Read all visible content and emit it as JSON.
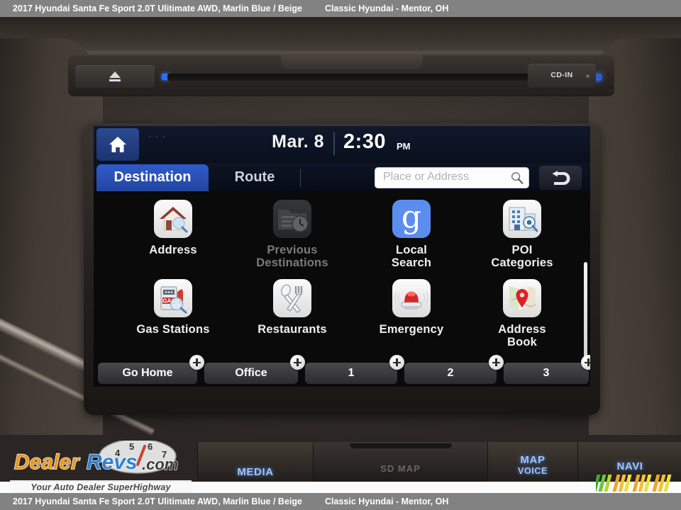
{
  "caption": {
    "vehicle": "2017 Hyundai Santa Fe Sport 2.0T Ulitimate AWD,  Marlin Blue / Beige",
    "dealer": "Classic Hyundai - Mentor, OH"
  },
  "head_unit": {
    "eject_icon": "eject-icon",
    "cd_in_label": "CD-IN"
  },
  "nav": {
    "status": {
      "home_icon": "home-icon",
      "dots": "· · ·",
      "date": "Mar.  8",
      "time": "2:30",
      "ampm": "PM"
    },
    "tabs": [
      {
        "label": "Destination",
        "active": true
      },
      {
        "label": "Route",
        "active": false
      }
    ],
    "search": {
      "placeholder": "Place or Address",
      "icon": "search-icon"
    },
    "back_icon": "back-arrow-icon",
    "grid": [
      {
        "label": "Address",
        "icon": "house-search-icon",
        "dim": false
      },
      {
        "label": "Previous\nDestinations",
        "icon": "folder-clock-icon",
        "dim": true
      },
      {
        "label": "Local\nSearch",
        "icon": "google-g-icon",
        "dim": false
      },
      {
        "label": "POI\nCategories",
        "icon": "building-search-icon",
        "dim": false
      },
      {
        "label": "Gas Stations",
        "icon": "gas-pump-icon",
        "dim": false
      },
      {
        "label": "Restaurants",
        "icon": "fork-spoon-icon",
        "dim": false
      },
      {
        "label": "Emergency",
        "icon": "siren-icon",
        "dim": false
      },
      {
        "label": "Address\nBook",
        "icon": "map-pin-icon",
        "dim": false
      }
    ],
    "shortcuts": [
      {
        "label": "Go Home",
        "badge": "+"
      },
      {
        "label": "Office",
        "badge": "+"
      },
      {
        "label": "1",
        "badge": "+"
      },
      {
        "label": "2",
        "badge": "+"
      },
      {
        "label": "3",
        "badge": "+"
      }
    ]
  },
  "hardware_buttons": [
    {
      "label": "MEDIA",
      "type": "button"
    },
    {
      "label": "SD MAP",
      "type": "sd-slot"
    },
    {
      "label": "MAP",
      "sublabel": "VOICE",
      "type": "button"
    },
    {
      "label": "NAVI",
      "type": "button"
    }
  ],
  "watermark": {
    "brand_dealer": "Dealer",
    "brand_revs": "Revs",
    "brand_com": ".com",
    "tagline": "Your Auto Dealer SuperHighway",
    "gauge_numbers": [
      "4",
      "5",
      "6",
      "7"
    ]
  },
  "colors": {
    "accent_blue": "#2d57c4",
    "tab_active": "#2f5bcc",
    "button_glow": "#9fc4ff",
    "caption_bar": "#828282",
    "lcd_bg": "#0a0a0b"
  }
}
